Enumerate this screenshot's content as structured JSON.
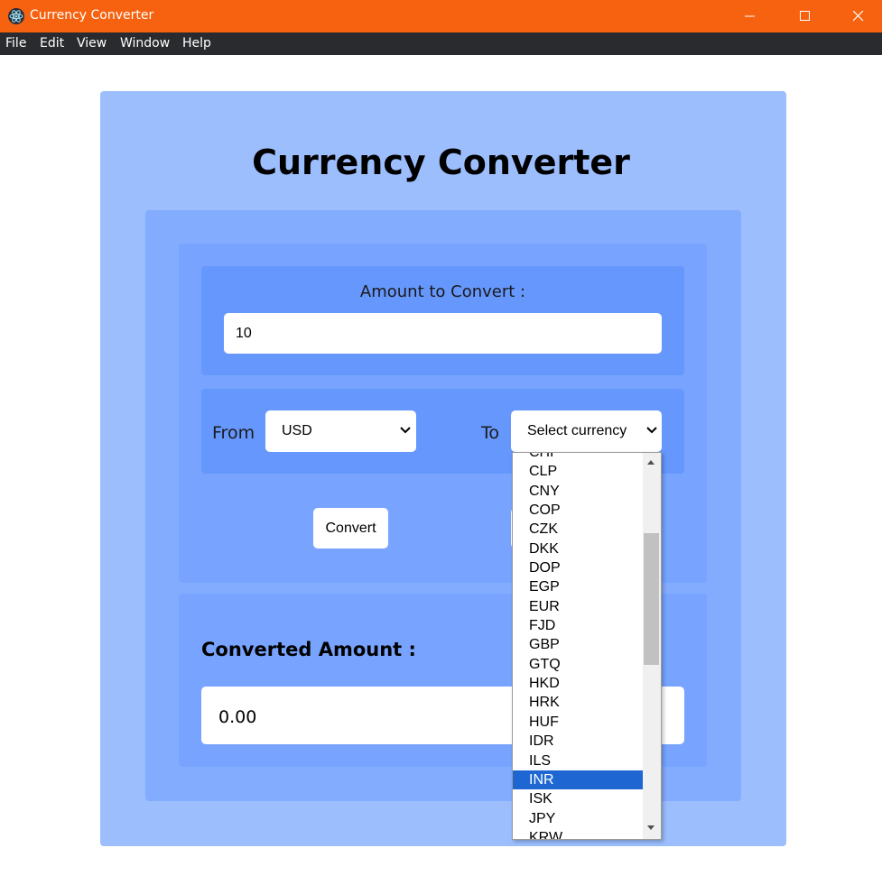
{
  "window": {
    "title": "Currency Converter",
    "icon": "electron-icon"
  },
  "menu": [
    "File",
    "Edit",
    "View",
    "Window",
    "Help"
  ],
  "app": {
    "heading": "Currency Converter",
    "amount_label": "Amount to Convert :",
    "amount_value": "10",
    "from_label": "From",
    "from_value": "USD",
    "to_label": "To",
    "to_value": "Select currency",
    "convert_label": "Convert",
    "converted_label": "Converted Amount :",
    "converted_value": "0.00"
  },
  "dropdown": {
    "options": [
      "CHF",
      "CLP",
      "CNY",
      "COP",
      "CZK",
      "DKK",
      "DOP",
      "EGP",
      "EUR",
      "FJD",
      "GBP",
      "GTQ",
      "HKD",
      "HRK",
      "HUF",
      "IDR",
      "ILS",
      "INR",
      "ISK",
      "JPY",
      "KRW"
    ],
    "highlighted": "INR"
  },
  "colors": {
    "titlebar": "#f6620f",
    "menubar": "#2a2b2e",
    "highlight": "#1e67d3"
  }
}
